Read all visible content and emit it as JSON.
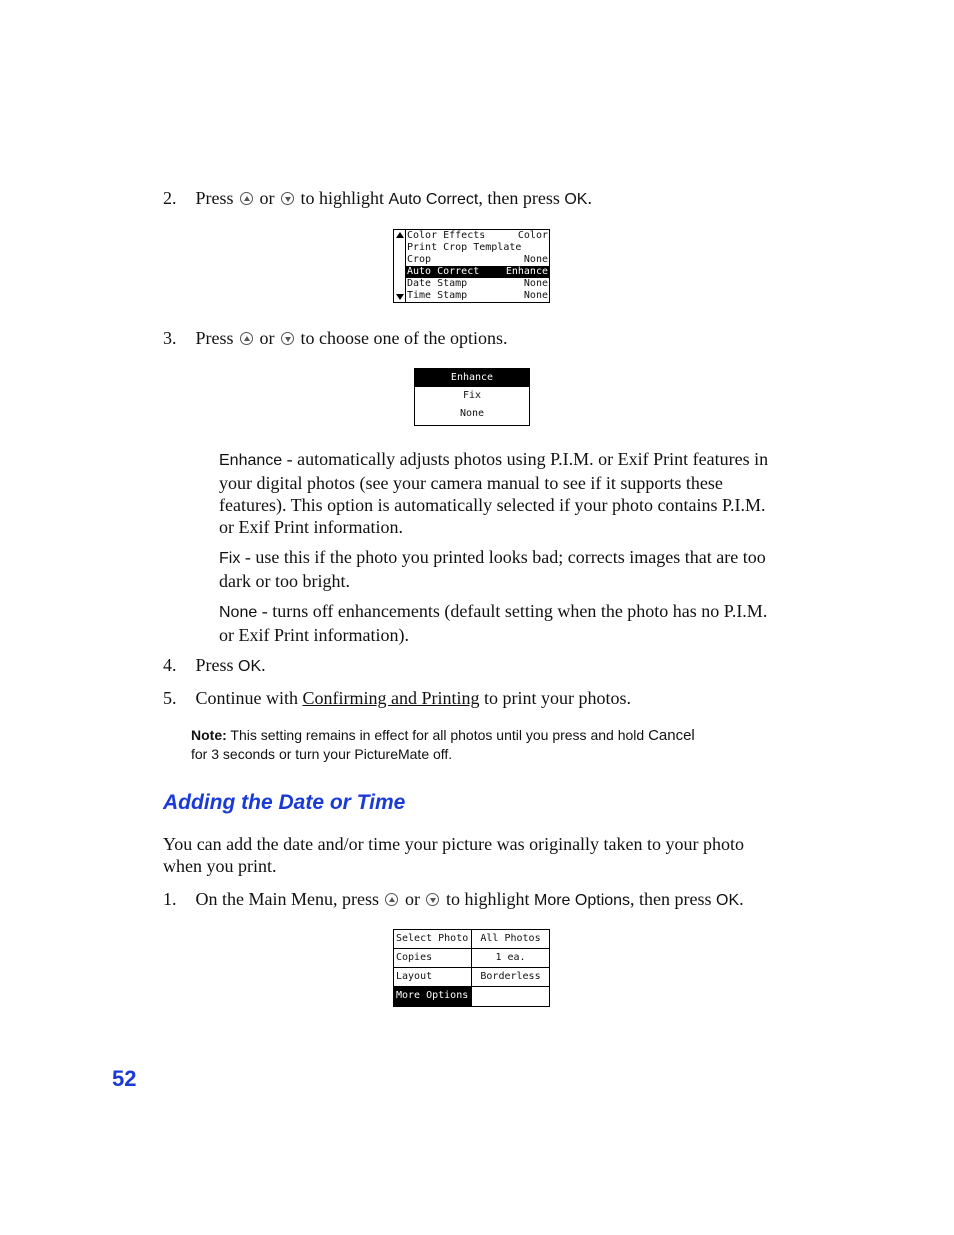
{
  "steps_a": {
    "step2": {
      "num": "2.",
      "press": "Press",
      "or": "or",
      "mid": "to highlight",
      "target": "Auto Correct",
      "then": ", then press",
      "ok": "OK",
      "end": "."
    },
    "step3": {
      "num": "3.",
      "press": "Press",
      "or": "or",
      "rest": "to choose one of the options."
    }
  },
  "lcd_menu": {
    "rows": [
      {
        "label": "Color Effects",
        "value": "Color",
        "selected": false
      },
      {
        "label": "Print Crop Template",
        "value": "",
        "selected": false
      },
      {
        "label": "Crop",
        "value": "None",
        "selected": false
      },
      {
        "label": "Auto Correct",
        "value": "Enhance",
        "selected": true
      },
      {
        "label": "Date Stamp",
        "value": "None",
        "selected": false
      },
      {
        "label": "Time Stamp",
        "value": "None",
        "selected": false
      }
    ]
  },
  "lcd_options": {
    "options": [
      "Enhance",
      "Fix",
      "None"
    ],
    "selected": "Enhance"
  },
  "descriptions": [
    {
      "term": "Enhance",
      "text": " - automatically adjusts photos using P.I.M. or Exif Print features in your digital photos (see your camera manual to see if it supports these features). This option is automatically selected if your photo contains P.I.M. or Exif Print information."
    },
    {
      "term": "Fix",
      "text": " - use this if the photo you printed looks bad; corrects images that are too dark or too bright."
    },
    {
      "term": "None",
      "text": " - turns off enhancements (default setting when the photo has no P.I.M. or Exif Print information)."
    }
  ],
  "steps_b": {
    "step4": {
      "num": "4.",
      "press": "Press",
      "ok": "OK",
      "end": "."
    },
    "step5": {
      "num": "5.",
      "pre": "Continue with",
      "link": "Confirming and Printing",
      "post": "to print your photos."
    }
  },
  "note": {
    "label": "Note:",
    "text1": " This setting remains in effect for all photos until you press and hold ",
    "cancel": "Cancel",
    "text2": "for 3 seconds or turn your PictureMate off."
  },
  "section": {
    "heading": "Adding the Date or Time",
    "intro": "You can add the date and/or time your picture was originally taken to your photo when you print.",
    "step1": {
      "num": "1.",
      "pre": "On the Main Menu, press",
      "or": "or",
      "mid": "to highlight",
      "target": "More Options",
      "then": ", then press",
      "ok": "OK",
      "end": "."
    }
  },
  "lcd_main": {
    "rows": [
      {
        "label": "Select Photo",
        "value": "All Photos",
        "selected": false
      },
      {
        "label": "Copies",
        "value": "1 ea.",
        "selected": false
      },
      {
        "label": "Layout",
        "value": "Borderless",
        "selected": false
      },
      {
        "label": "More Options",
        "value": "",
        "selected": true
      }
    ]
  },
  "page_number": "52",
  "colors": {
    "heading": "#1a3ad6",
    "page_number": "#1a3ad6"
  }
}
